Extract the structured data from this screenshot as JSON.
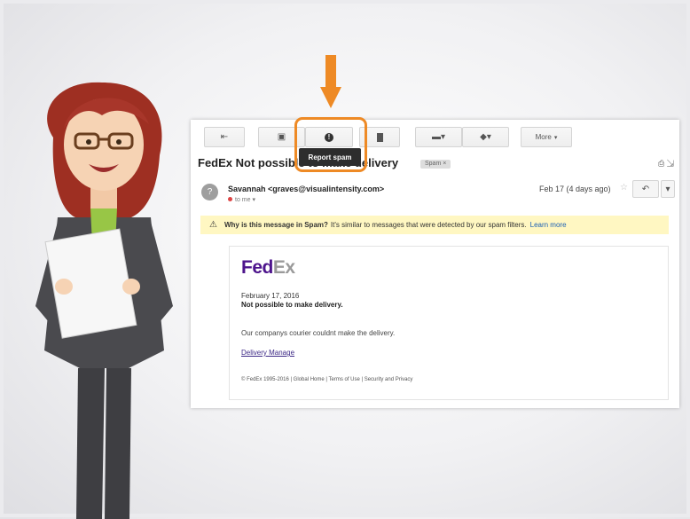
{
  "toolbar": {
    "buttons": [
      {
        "name": "reply-button",
        "icon": "reply-icon",
        "glyph": "⇤"
      },
      {
        "name": "archive-button",
        "icon": "archive-icon",
        "glyph": "▣"
      },
      {
        "name": "report-spam-button",
        "icon": "exclamation-icon",
        "glyph": "!"
      },
      {
        "name": "delete-button",
        "icon": "trash-icon",
        "glyph": "🗑"
      },
      {
        "name": "move-to-button",
        "icon": "folder-icon",
        "glyph": "▬▾"
      },
      {
        "name": "labels-button",
        "icon": "tag-icon",
        "glyph": "◆▾"
      }
    ],
    "more_label": "More",
    "more_caret": "▾",
    "tooltip": "Report spam"
  },
  "subject": {
    "text": "FedEx Not possible to make delivery",
    "label": "Spam ×",
    "icons": "⎙ ⇲"
  },
  "sender": {
    "avatar_letter": "?",
    "from": "Savannah <graves@visualintensity.com>",
    "to": "to me",
    "to_caret": "▾",
    "date": "Feb 17 (4 days ago)",
    "star": "☆",
    "reply_glyph": "↶",
    "more_glyph": "▾"
  },
  "warning": {
    "icon": "warning-icon",
    "glyph": "⚠",
    "question": "Why is this message in Spam?",
    "text": "It's similar to messages that were detected by our spam filters.",
    "link": "Learn more"
  },
  "email": {
    "logo_fed": "Fed",
    "logo_ex": "Ex",
    "date": "February 17, 2016",
    "headline": "Not possible to make delivery.",
    "body": "Our companys courier couldnt make the delivery.",
    "link": "Delivery Manage",
    "footer": "© FedEx 1995-2016 | Global Home | Terms of Use | Security and Privacy"
  },
  "colors": {
    "accent_orange": "#ee8a25",
    "fedex_purple": "#4d148c",
    "warning_bg": "#fff7c2"
  }
}
